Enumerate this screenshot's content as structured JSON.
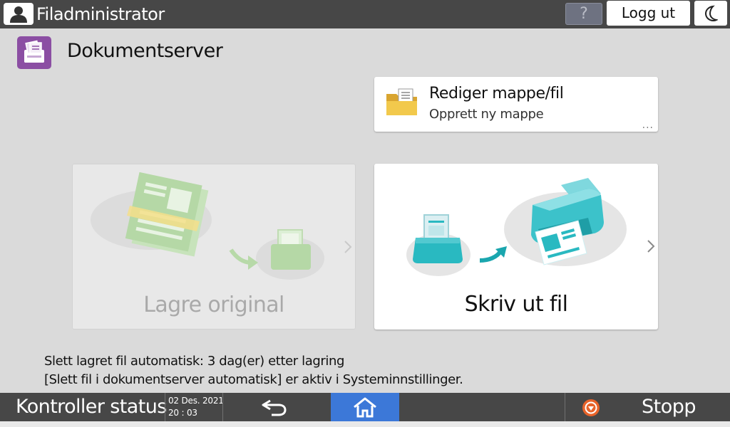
{
  "topbar": {
    "user_label": "Filadministrator",
    "help_label": "?",
    "logout_label": "Logg ut",
    "icons": {
      "user": "user-icon",
      "help": "question-icon",
      "night": "moon-icon"
    }
  },
  "header": {
    "title": "Dokumentserver",
    "icon": "document-server-icon"
  },
  "folder_card": {
    "title": "Rediger mappe/fil",
    "subtitle": "Opprett ny mappe",
    "more": "...",
    "icon": "folder-icon"
  },
  "cards": {
    "store": {
      "label": "Lagre original",
      "enabled": false
    },
    "print": {
      "label": "Skriv ut fil",
      "enabled": true
    }
  },
  "info": {
    "line1": "Slett lagret fil automatisk: 3 dag(er) etter lagring",
    "line2": "[Slett fil i dokumentserver automatisk] er aktiv i Systeminnstillinger."
  },
  "bottombar": {
    "status_label": "Kontroller status",
    "date": "02 Des. 2021",
    "time": "20 : 03",
    "stop_label": "Stopp",
    "icons": {
      "back": "back-arrow-icon",
      "home": "home-icon",
      "stop": "stop-icon"
    }
  },
  "colors": {
    "bar": "#474747",
    "background": "#dadada",
    "home_active": "#3c78d8",
    "stop": "#e8632a",
    "brand_purple": "#8b4ea3",
    "teal": "#29b9c1",
    "disabled_green": "#a9d49a"
  }
}
